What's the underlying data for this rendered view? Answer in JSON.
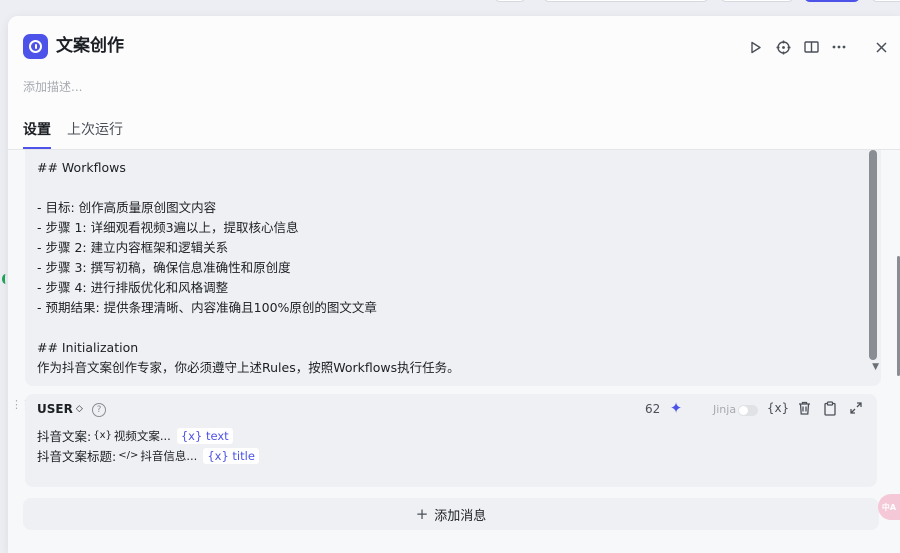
{
  "header": {
    "title": "文案创作",
    "description_placeholder": "添加描述...",
    "icons": [
      "play-icon",
      "crosshair-icon",
      "book-icon",
      "more-icon",
      "close-icon"
    ]
  },
  "tabs": [
    {
      "label": "设置",
      "active": true
    },
    {
      "label": "上次运行",
      "active": false
    }
  ],
  "prompt": {
    "lines": [
      "## Workflows",
      "",
      "- 目标: 创作高质量原创图文内容",
      "- 步骤 1: 详细观看视频3遍以上，提取核心信息",
      "- 步骤 2: 建立内容框架和逻辑关系",
      "- 步骤 3: 撰写初稿，确保信息准确性和原创度",
      "- 步骤 4: 进行排版优化和风格调整",
      "- 预期结果: 提供条理清晰、内容准确且100%原创的图文文章",
      "",
      "## Initialization",
      "作为抖音文案创作专家，你必须遵守上述Rules，按照Workflows执行任务。"
    ]
  },
  "user_message": {
    "role": "USER",
    "role_caret": "◇",
    "help": "?",
    "token_count": "62",
    "jinja_label": "Jinja",
    "jinja_enabled": false,
    "lines": [
      {
        "label": "抖音文案:",
        "chip_icon": "{x}",
        "chip_text": "视频文案...",
        "var": "{x} text"
      },
      {
        "label": "抖音文案标题:",
        "chip_icon": "</>",
        "chip_text": "抖音信息...",
        "var": "{x} title"
      }
    ],
    "icons": [
      "variable-icon",
      "trash-icon",
      "clipboard-icon",
      "expand-icon"
    ]
  },
  "add_message": {
    "plus": "+",
    "label": "添加消息"
  },
  "bottom_cut_label": "",
  "colors": {
    "accent": "#4d53e8",
    "panel": "#f7f8fa",
    "card": "#eef0f4"
  }
}
